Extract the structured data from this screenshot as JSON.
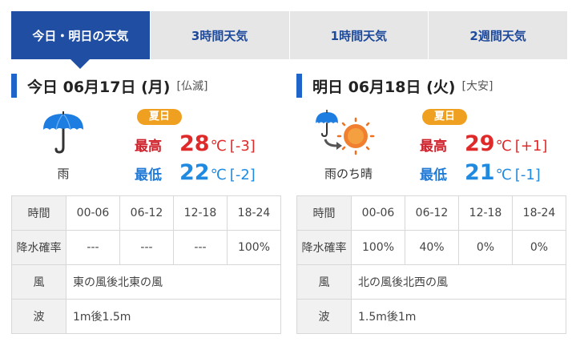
{
  "tabs": [
    {
      "label": "今日・明日の天気",
      "active": true
    },
    {
      "label": "3時間天気",
      "active": false
    },
    {
      "label": "1時間天気",
      "active": false
    },
    {
      "label": "2週間天気",
      "active": false
    }
  ],
  "today": {
    "title": "今日 06月17日 (月)",
    "rokuyo": "[仏滅]",
    "weather_icon": "umbrella-icon",
    "weather": "雨",
    "badge": "夏日",
    "high_label": "最高",
    "high_value": "28",
    "high_unit": "℃",
    "high_diff": "[-3]",
    "low_label": "最低",
    "low_value": "22",
    "low_unit": "℃",
    "low_diff": "[-2]",
    "table": {
      "time_header": "時間",
      "periods": [
        "00-06",
        "06-12",
        "12-18",
        "18-24"
      ],
      "rain_header": "降水確率",
      "rain": [
        "---",
        "---",
        "---",
        "100%"
      ],
      "wind_header": "風",
      "wind": "東の風後北東の風",
      "wave_header": "波",
      "wave": "1m後1.5m"
    }
  },
  "tomorrow": {
    "title": "明日 06月18日 (火)",
    "rokuyo": "[大安]",
    "weather_icon": "rain-then-sun-icon",
    "weather": "雨のち晴",
    "badge": "夏日",
    "high_label": "最高",
    "high_value": "29",
    "high_unit": "℃",
    "high_diff": "[+1]",
    "low_label": "最低",
    "low_value": "21",
    "low_unit": "℃",
    "low_diff": "[-1]",
    "table": {
      "time_header": "時間",
      "periods": [
        "00-06",
        "06-12",
        "12-18",
        "18-24"
      ],
      "rain_header": "降水確率",
      "rain": [
        "100%",
        "40%",
        "0%",
        "0%"
      ],
      "wind_header": "風",
      "wind": "北の風後北西の風",
      "wave_header": "波",
      "wave": "1.5m後1m"
    }
  },
  "colors": {
    "tab_active": "#1f4ea3",
    "tab_inactive": "#e6e6e6",
    "high": "#e02a2a",
    "low": "#1f8ae0",
    "badge": "#f0a020",
    "header_bar": "#1f64c8"
  }
}
